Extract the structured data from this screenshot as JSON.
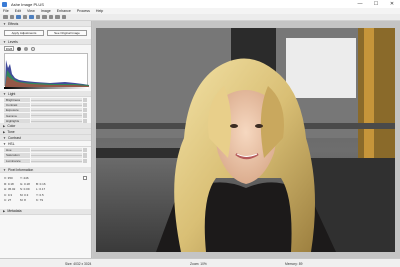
{
  "window": {
    "title": "Ashe Image PLUS",
    "controls": [
      "—",
      "☐",
      "✕"
    ]
  },
  "menu": [
    "File",
    "Edit",
    "View",
    "Image",
    "Enhance",
    "Process",
    "Help"
  ],
  "panels": {
    "effects": {
      "title": "Effects"
    },
    "apply_button": "Apply Adjustments",
    "original_button": "See Original Image",
    "levels": {
      "title": "Levels",
      "mode": "RGB"
    },
    "light": {
      "title": "Light",
      "rows": [
        "Brightness",
        "Contrast",
        "Exposure",
        "Gamma",
        "Highlights"
      ]
    },
    "color": {
      "title": "Color"
    },
    "tone": {
      "title": "Tone"
    },
    "contrast": {
      "title": "Contrast"
    },
    "hsl": {
      "title": "HSL",
      "rows": [
        "Hue",
        "Saturation",
        "Luminance"
      ]
    },
    "pixel_info": {
      "title": "Pixel Information",
      "rows": [
        [
          "X: 350",
          "Y: 246",
          ""
        ],
        [
          "R: 0.18",
          "G: 0.18",
          "B: 0.16"
        ],
        [
          "H: 45.02",
          "S: 0.09",
          "L: 0.17"
        ],
        [
          "C: 0.3",
          "M: 0.3",
          "Y: 0.5"
        ],
        [
          "C: 27",
          "M: 8",
          "K: 79"
        ]
      ]
    },
    "metadata": {
      "title": "Metadata"
    }
  },
  "status": {
    "size": "Size: 4032 x 3024",
    "zoom": "Zoom: 10%",
    "memory": "Memory: 89"
  },
  "colors": {
    "accent": "#4d7fbf",
    "panel_bg": "#f7f7f7"
  }
}
